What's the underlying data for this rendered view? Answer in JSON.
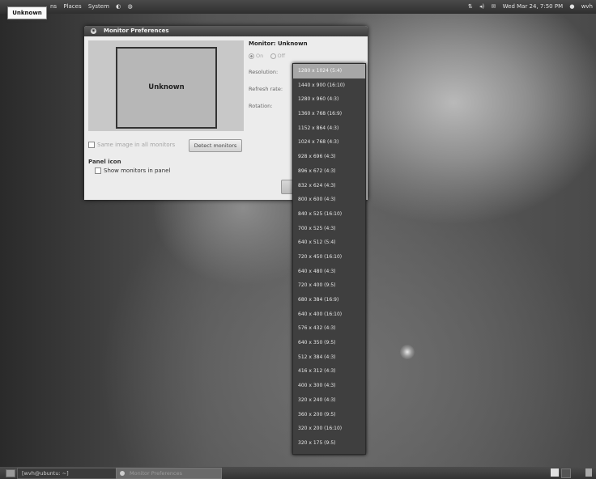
{
  "top_panel": {
    "menus": [
      "ns",
      "Places",
      "System"
    ],
    "datetime": "Wed Mar 24,  7:50 PM",
    "user": "wvh"
  },
  "tooltip": "Unknown",
  "dialog": {
    "title": "Monitor Preferences",
    "preview_label": "Unknown",
    "mirror_label": "Same image in all monitors",
    "detect_button": "Detect monitors",
    "panel_icon_heading": "Panel icon",
    "show_monitors_label": "Show monitors in panel",
    "monitor_heading": "Monitor: Unknown",
    "on_label": "On",
    "off_label": "Off",
    "resolution_label": "Resolution:",
    "refresh_label": "Refresh rate:",
    "rotation_label": "Rotation:"
  },
  "resolutions": [
    "1280 x 1024 (5:4)",
    "1440 x 900 (16:10)",
    "1280 x 960 (4:3)",
    "1360 x 768 (16:9)",
    "1152 x 864 (4:3)",
    "1024 x 768 (4:3)",
    "928 x 696 (4:3)",
    "896 x 672 (4:3)",
    "832 x 624 (4:3)",
    "800 x 600 (4:3)",
    "840 x 525 (16:10)",
    "700 x 525 (4:3)",
    "640 x 512 (5:4)",
    "720 x 450 (16:10)",
    "640 x 480 (4:3)",
    "720 x 400 (9:5)",
    "680 x 384 (16:9)",
    "640 x 400 (16:10)",
    "576 x 432 (4:3)",
    "640 x 350 (9:5)",
    "512 x 384 (4:3)",
    "416 x 312 (4:3)",
    "400 x 300 (4:3)",
    "320 x 240 (4:3)",
    "360 x 200 (9:5)",
    "320 x 200 (16:10)",
    "320 x 175 (9:5)"
  ],
  "selected_resolution_index": 0,
  "bottom_panel": {
    "task_terminal": "[wvh@ubuntu: ~]",
    "task_monitor": "Monitor Preferences"
  }
}
